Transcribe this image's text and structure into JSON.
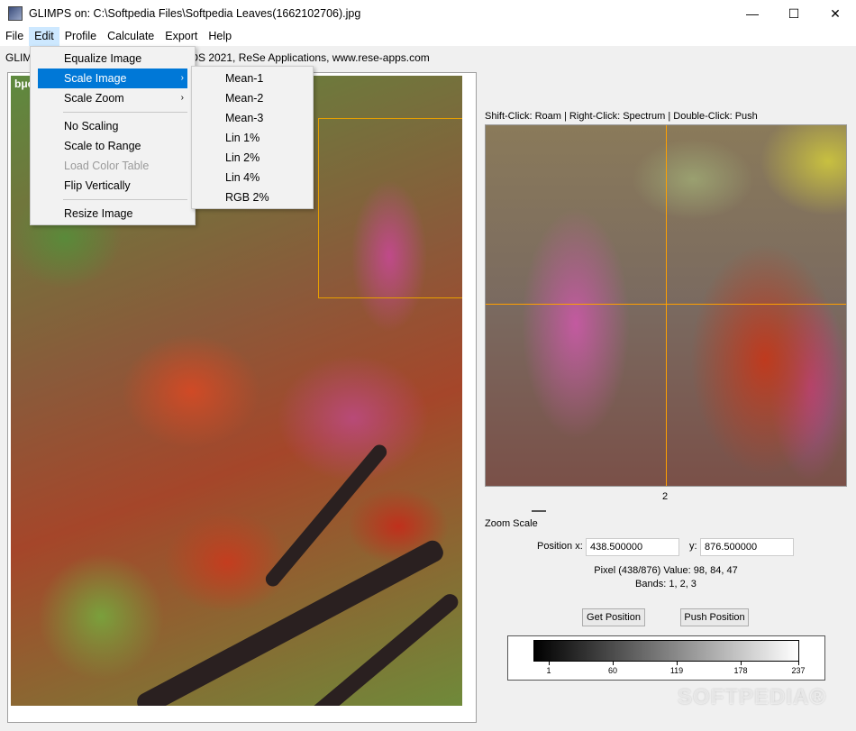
{
  "window": {
    "title": "GLIMPS on: C:\\Softpedia Files\\Softpedia Leaves(1662102706).jpg",
    "minimize": "—",
    "maximize": "☐",
    "close": "✕"
  },
  "menubar": [
    "File",
    "Edit",
    "Profile",
    "Calculate",
    "Export",
    "Help"
  ],
  "info_line": {
    "start": "GLIM",
    "tail": ") DS 2021, ReSe Applications, www.rese-apps.com"
  },
  "left_panel": {
    "label": "bμc"
  },
  "hint": "Shift-Click: Roam | Right-Click: Spectrum | Double-Click: Push",
  "zoom": {
    "factor": "2",
    "scale_label": "Zoom Scale",
    "position_label": "Position  x:",
    "x_value": "438.500000",
    "y_label": "y:",
    "y_value": "876.500000",
    "pixel_info": "Pixel (438/876) Value: 98, 84, 47",
    "bands": "Bands:  1,  2,  3",
    "get_position": "Get Position",
    "push_position": "Push Position"
  },
  "colorbar": {
    "ticks": [
      "1",
      "60",
      "119",
      "178",
      "237"
    ]
  },
  "edit_menu": {
    "items": [
      {
        "label": "Equalize Image"
      },
      {
        "label": "Scale Image",
        "arrow": "›"
      },
      {
        "label": "Scale Zoom",
        "arrow": "›"
      },
      {
        "label": "No Scaling"
      },
      {
        "label": "Scale to Range"
      },
      {
        "label": "Load Color Table"
      },
      {
        "label": "Flip Vertically"
      },
      {
        "label": "Resize Image"
      }
    ]
  },
  "scale_submenu": [
    "Mean-1",
    "Mean-2",
    "Mean-3",
    "Lin 1%",
    "Lin 2%",
    "Lin 4%",
    "RGB 2%"
  ],
  "watermark": "SOFTPEDIA®"
}
